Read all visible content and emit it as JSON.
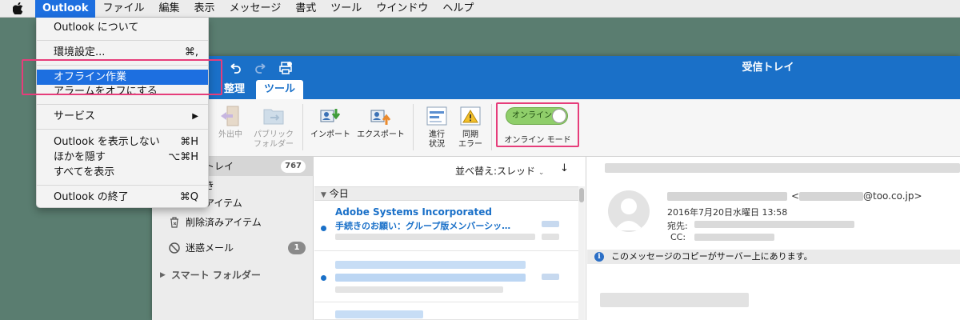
{
  "menubar": {
    "app": "Outlook",
    "items": [
      "ファイル",
      "編集",
      "表示",
      "メッセージ",
      "書式",
      "ツール",
      "ウインドウ",
      "ヘルプ"
    ]
  },
  "app_menu": {
    "about": "Outlook について",
    "preferences": "環境設定...",
    "preferences_shortcut": "⌘,",
    "work_offline": "オフライン作業",
    "turn_off_alarms": "アラームをオフにする",
    "services": "サービス",
    "hide_outlook": "Outlook を表示しない",
    "hide_outlook_shortcut": "⌘H",
    "hide_others": "ほかを隠す",
    "hide_others_shortcut": "⌥⌘H",
    "show_all": "すべてを表示",
    "quit": "Outlook の終了",
    "quit_shortcut": "⌘Q"
  },
  "window": {
    "title": "受信トレイ",
    "tabs": [
      "整理",
      "ツール"
    ],
    "active_tab": "ツール"
  },
  "ribbon": {
    "outbox": "外出中",
    "public_folders": [
      "パブリック",
      "フォルダー"
    ],
    "import": "インポート",
    "export": "エクスポート",
    "progress": [
      "進行",
      "状況"
    ],
    "sync_errors": [
      "同期",
      "エラー"
    ],
    "online_toggle": "オンライン",
    "online_mode": "オンライン モード"
  },
  "folders": {
    "inbox_partial": "トレイ",
    "inbox_count": "767",
    "draft_partial": "き",
    "sent_partial": "済みアイテム",
    "deleted": "削除済みアイテム",
    "junk": "迷惑メール",
    "junk_count": "1",
    "smart_folders": "スマート フォルダー"
  },
  "message_list": {
    "sort": "並べ替え:スレッド",
    "sort_arrow": "↓",
    "group_today": "今日",
    "first": {
      "sender": "Adobe Systems Incorporated",
      "subject": "手続きのお願い：グループ版メンバーシッ…"
    }
  },
  "reading": {
    "email_prefix": "<",
    "email_domain": "@too.co.jp>",
    "date": "2016年7月20日水曜日 13:58",
    "to_label": "宛先:",
    "cc_label": "CC:",
    "info_text": "このメッセージのコピーがサーバー上にあります。"
  },
  "colors": {
    "accent": "#1a70c8",
    "highlight_box": "#e63d7a",
    "toggle_on": "#8fce6a",
    "desktop": "#5a7d70"
  }
}
